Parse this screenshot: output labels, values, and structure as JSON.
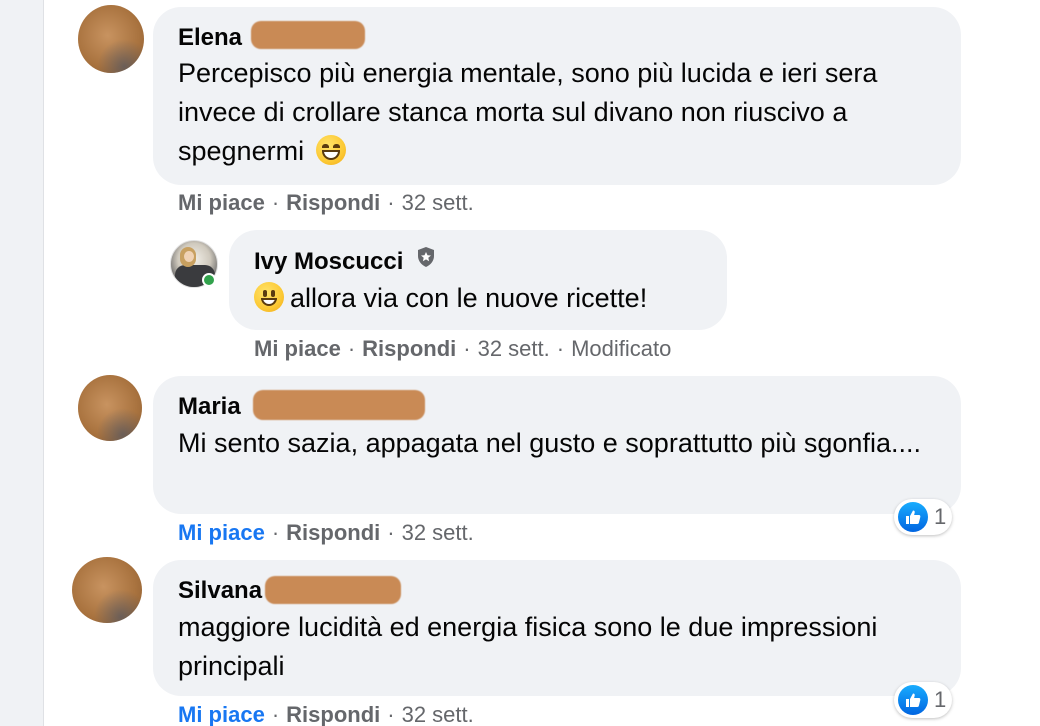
{
  "comments": [
    {
      "author": "Elena",
      "text": "Percepisco più energia mentale, sono più lucida e ieri sera invece di crollare stanca morta sul divano non riuscivo a spegnermi",
      "emoji": "grinning-face-with-smiling-eyes",
      "actions": {
        "like": "Mi piace",
        "reply": "Rispondi",
        "time": "32 sett."
      }
    },
    {
      "author": "Ivy Moscucci",
      "badge_icon": "shield-icon",
      "emoji": "grinning-face",
      "text": "allora via con le nuove ricette!",
      "actions": {
        "like": "Mi piace",
        "reply": "Rispondi",
        "time": "32 sett.",
        "edited": "Modificato"
      },
      "online": true
    },
    {
      "author": "Maria",
      "text": "Mi sento sazia, appagata nel gusto e soprattutto più sgonfia....",
      "actions": {
        "like": "Mi piace",
        "reply": "Rispondi",
        "time": "32 sett."
      },
      "liked": true,
      "reactions": {
        "icon": "like-icon",
        "count": "1"
      }
    },
    {
      "author": "Silvana",
      "text": "maggiore lucidità ed energia fisica sono le due impressioni principali",
      "actions": {
        "like": "Mi piace",
        "reply": "Rispondi",
        "time": "32 sett."
      },
      "liked": true,
      "reactions": {
        "icon": "like-icon",
        "count": "1"
      }
    }
  ],
  "separator": "·",
  "colors": {
    "bubble": "#f0f2f5",
    "text": "#050505",
    "muted": "#65676b",
    "liked": "#1877f2",
    "online": "#31a24c",
    "redaction": "#c98a55"
  }
}
